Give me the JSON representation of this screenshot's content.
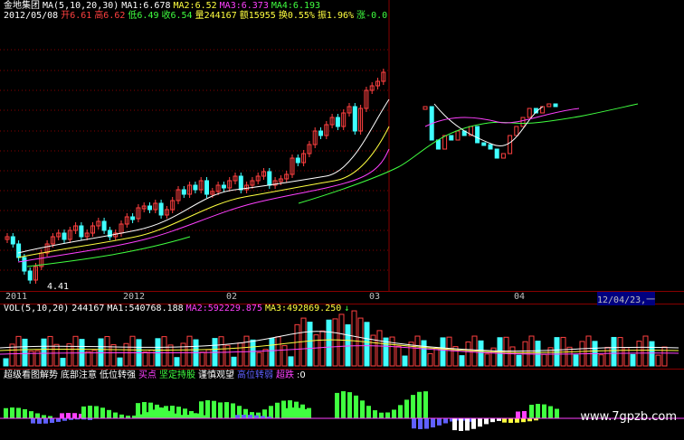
{
  "header": {
    "stock_name": "金地集团",
    "ma_label": "MA(5,10,20,30)",
    "ma1": "MA1:6.678",
    "ma2": "MA2:6.52",
    "ma3": "MA3:6.373",
    "ma4": "MA4:6.193",
    "up_arrow": "↑",
    "date": "2012/05/08",
    "open": "开6.61",
    "high": "高6.62",
    "low": "低6.49",
    "close": "收6.54",
    "volume": "量244167",
    "amount": "额15955",
    "turnover": "换0.55%",
    "amplitude": "振1.96%",
    "change": "涨-0.0",
    "down_arrow": "↓"
  },
  "price_panel": {
    "low_label": "4.41"
  },
  "axis": {
    "labels": [
      "2011",
      "2012",
      "02",
      "03",
      "04"
    ],
    "cursor_date": "12/04/23,一"
  },
  "vol_panel": {
    "title": "VOL(5,10,20)",
    "vol": "244167",
    "ma1": "MA1:540768.188",
    "ma2": "MA2:592229.875",
    "ma3": "MA3:492869.250",
    "arrow": "↓"
  },
  "indicator_panel": {
    "title": "超级看图解势",
    "items": [
      "底部注意",
      "低位转强",
      "买点",
      "坚定持股",
      "谨慎观望",
      "高位转弱",
      "超跌"
    ],
    "tail": ":0"
  },
  "watermark": "www.7gpzb.com",
  "colors": {
    "up": "#ff4040",
    "down": "#40ffff",
    "ma1": "#ffffff",
    "ma2": "#ffff40",
    "ma3": "#ff40ff",
    "ma4": "#40ff40",
    "grid": "#880000"
  }
}
